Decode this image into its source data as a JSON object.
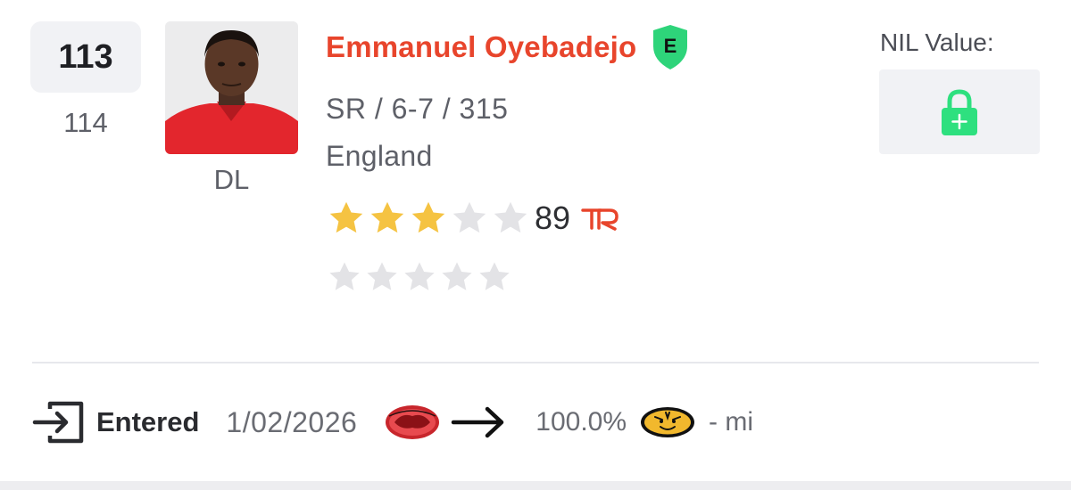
{
  "ranking": {
    "current": "113",
    "previous": "114"
  },
  "player": {
    "name": "Emmanuel Oyebadejo",
    "badge_letter": "E",
    "position": "DL",
    "class_height_weight": "SR / 6-7 / 315",
    "hometown": "England",
    "stars_primary": 3,
    "stars_primary_total": 5,
    "rating": "89",
    "rating_source_logo": "TR",
    "stars_secondary": 0,
    "stars_secondary_total": 5,
    "icons": {
      "badge": "shield-badge-icon",
      "star": "star-icon",
      "lock": "lock-plus-icon"
    }
  },
  "nil": {
    "label": "NIL Value:"
  },
  "transfer": {
    "status": "Entered",
    "date": "1/02/2026",
    "percent": "100.0%",
    "distance": "- mi",
    "icons": {
      "status": "enter-icon",
      "from": "previous-school-logo",
      "arrow": "arrow-right-icon",
      "to": "missouri-tigers-logo"
    }
  },
  "colors": {
    "name": "#e8452c",
    "badge": "#2ed47a",
    "star_filled": "#f5c342",
    "star_empty": "#e3e3e6",
    "lock": "#2ee07f",
    "tr_logo": "#e8452c"
  }
}
